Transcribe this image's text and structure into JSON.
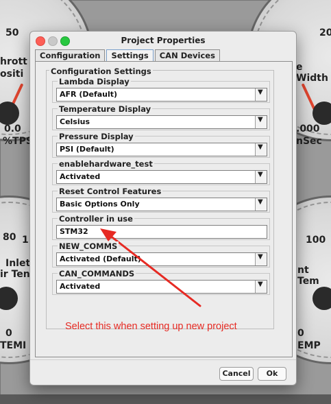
{
  "window": {
    "title": "Project Properties"
  },
  "tabs": [
    {
      "label": "Configuration"
    },
    {
      "label": "Settings"
    },
    {
      "label": "CAN Devices"
    }
  ],
  "active_tab": "Settings",
  "group_label": "Configuration Settings",
  "fields": [
    {
      "label": "Lambda Display",
      "value": "AFR (Default)"
    },
    {
      "label": "Temperature Display",
      "value": "Celsius"
    },
    {
      "label": "Pressure Display",
      "value": "PSI (Default)"
    },
    {
      "label": "enablehardware_test",
      "value": "Activated"
    },
    {
      "label": "Reset Control Features",
      "value": "Basic Options Only"
    },
    {
      "label": "Controller in use",
      "value": "STM32"
    },
    {
      "label": "NEW_COMMS",
      "value": "Activated (Default)"
    },
    {
      "label": "CAN_COMMANDS",
      "value": "Activated"
    }
  ],
  "buttons": {
    "cancel": "Cancel",
    "ok": "Ok"
  },
  "annotation": {
    "text": "Select this when setting up new project",
    "color": "#e62a23"
  },
  "background_gauges": {
    "left_top": {
      "scale_value": "50",
      "title_partial": [
        "hrott",
        "ositi"
      ],
      "reading": "0.0",
      "unit_partial": "%TPS"
    },
    "right_top": {
      "scale_value": "20",
      "title_partial": "e Width",
      "reading": ".000",
      "unit_partial": "nSec"
    },
    "left_bottom": {
      "scale_value": "80",
      "scale_value2": "1",
      "title_partial": [
        "Inlet",
        "ir Ten"
      ],
      "reading": "0",
      "unit_partial": "TEMI"
    },
    "right_bottom": {
      "scale_value": "100",
      "title_partial": "nt Tem",
      "reading": "0",
      "unit_partial": "EMP"
    }
  }
}
